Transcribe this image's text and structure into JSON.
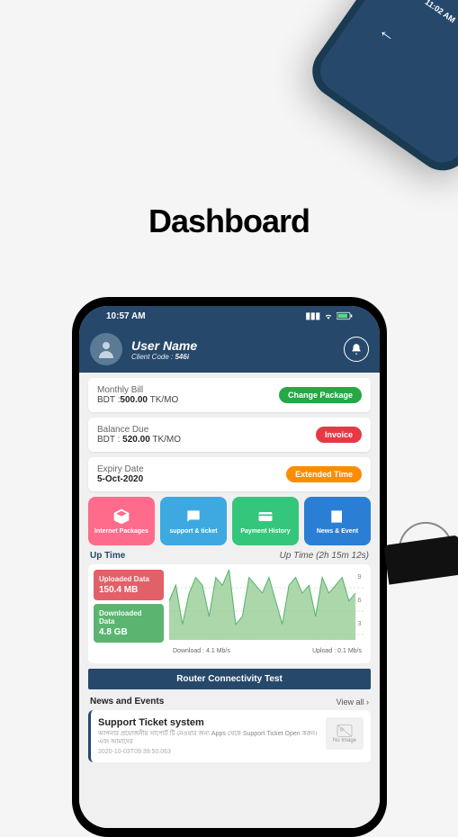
{
  "page_title": "Dashboard",
  "phone2": {
    "time": "11:02 AM"
  },
  "status": {
    "time": "10:57 AM"
  },
  "header": {
    "user_name": "User Name",
    "client_code_label": "Client Code :",
    "client_code": "546i"
  },
  "bill": {
    "label": "Monthly Bill",
    "prefix": "BDT :",
    "value": "500.00",
    "suffix": "TK/MO",
    "button": "Change Package"
  },
  "balance": {
    "label": "Balance Due",
    "prefix": "BDT :",
    "value": "520.00",
    "suffix": "TK/MO",
    "button": "Invoice"
  },
  "expiry": {
    "label": "Expiry Date",
    "value": "5-Oct-2020",
    "button": "Extended Time"
  },
  "tiles": [
    {
      "label": "Internet\nPackages"
    },
    {
      "label": "support\n& ticket"
    },
    {
      "label": "Payment\nHistory"
    },
    {
      "label": "News\n& Event"
    }
  ],
  "uptime": {
    "label": "Up Time",
    "value_label": "Up Time (2h 15m 12s)",
    "uploaded_label": "Uploaded Data",
    "uploaded_value": "150.4 MB",
    "downloaded_label": "Downloaded Data",
    "downloaded_value": "4.8 GB",
    "download_speed_label": "Download :",
    "download_speed": "4.1 Mb/s",
    "upload_speed_label": "Upload :",
    "upload_speed": "0.1 Mb/s"
  },
  "router_button": "Router Connectivity Test",
  "news": {
    "header": "News and Events",
    "viewall": "View all",
    "item": {
      "title": "Support Ticket system",
      "body": "আপনার প্রয়োজনীয় সাপোর্ট টি নেওয়ার জন্য Apps থেকে Support Ticket Open করুন। এবং আমাদের",
      "date": "2020-10-03T09:39:50.063",
      "no_image": "No Image"
    }
  },
  "chart_data": {
    "type": "area",
    "ylim": [
      0,
      9
    ],
    "yticks": [
      3,
      6,
      9
    ],
    "series": [
      {
        "name": "Download",
        "color": "#8fc98f",
        "values": [
          5,
          7,
          2,
          6,
          8,
          7,
          3,
          8,
          7,
          9,
          2,
          3,
          8,
          7,
          6,
          8,
          5,
          2,
          7,
          8,
          6,
          7,
          3,
          8,
          6,
          7,
          8,
          5,
          6
        ]
      }
    ]
  }
}
